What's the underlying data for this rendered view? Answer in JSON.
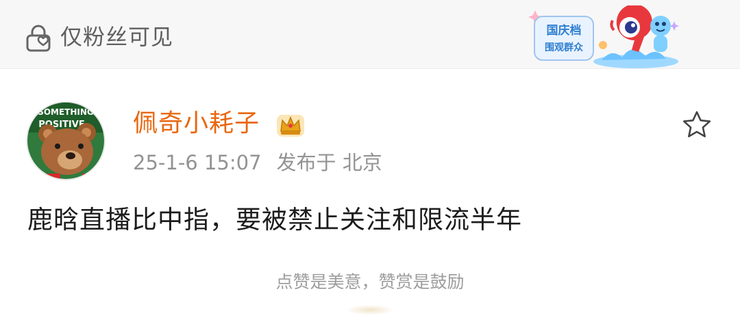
{
  "visibility": {
    "icon": "lock-heart-icon",
    "label": "仅粉丝可见"
  },
  "event_badge": {
    "line1": "国庆档",
    "line2": "围观群众"
  },
  "post": {
    "avatar_text_top": "SOMETHING",
    "avatar_text_mid": "POSITIVE",
    "username": "佩奇小耗子",
    "vip_icon": "crown-vip-icon",
    "timestamp": "25-1-6 15:07",
    "published": "发布于 北京",
    "favorite_icon": "star-outline-icon",
    "text": "鹿晗直播比中指，要被禁止关注和限流半年"
  },
  "footer": {
    "reward_text": "点赞是美意，赞赏是鼓励"
  },
  "colors": {
    "username": "#e8670f",
    "meta": "#939393",
    "body": "#1c1c1c",
    "bar_bg": "#f7f7f7"
  }
}
